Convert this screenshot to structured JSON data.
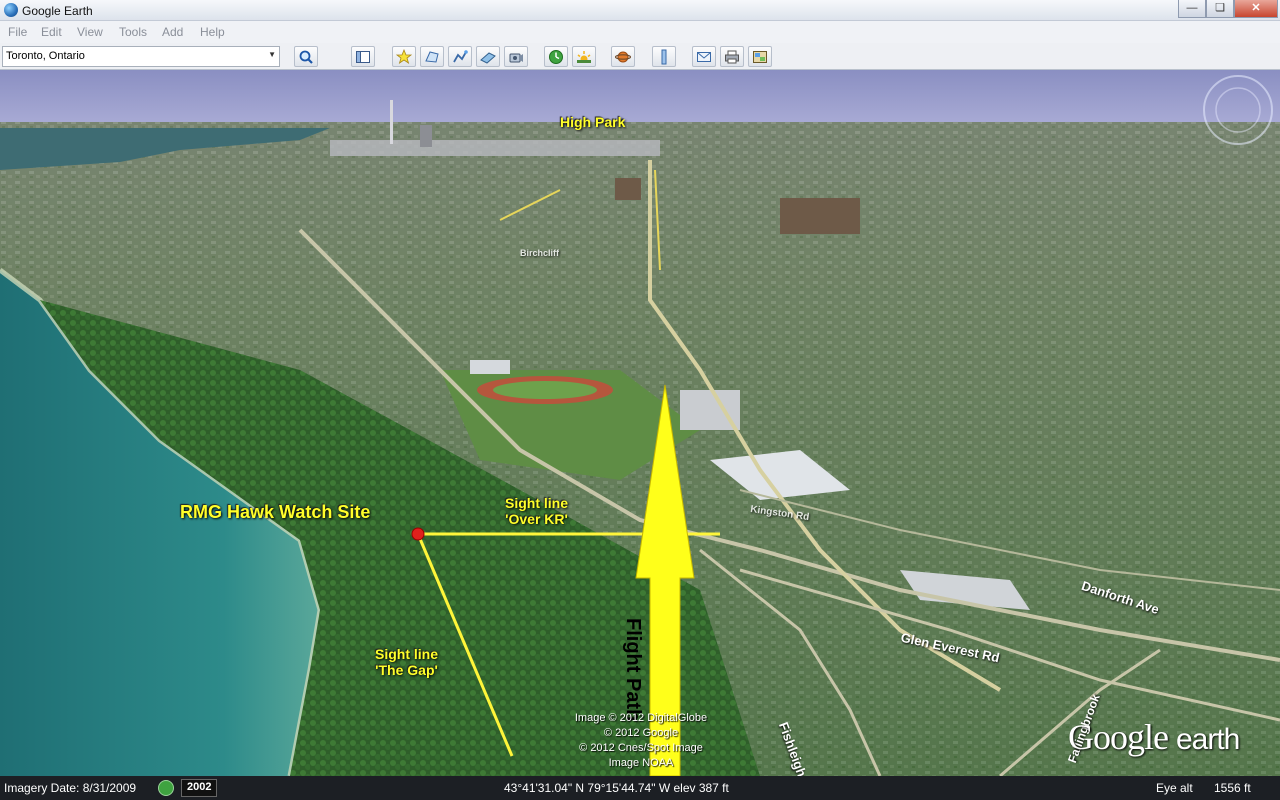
{
  "window": {
    "title": "Google Earth"
  },
  "menu": [
    "File",
    "Edit",
    "View",
    "Tools",
    "Add",
    "Help"
  ],
  "search": {
    "value": "Toronto, Ontario"
  },
  "map": {
    "labels": {
      "high_park": "High Park",
      "site": "RMG Hawk Watch Site",
      "sight_kr_1": "Sight line",
      "sight_kr_2": "'Over KR'",
      "sight_gap_1": "Sight line",
      "sight_gap_2": "'The Gap'",
      "flight_path": "Flight Path"
    },
    "roads": {
      "danforth": "Danforth Ave",
      "glen_everest": "Glen Everest Rd",
      "fishleigh": "Fishleigh Dr",
      "kingston": "Kingston Rd",
      "fallingbrook": "Fallingbrook",
      "birchcliff": "Birchcliff"
    },
    "credits": [
      "Image © 2012 DigitalGlobe",
      "© 2012 Google",
      "© 2012 Cnes/Spot Image",
      "Image NOAA"
    ],
    "brand_main": "Google",
    "brand_sub": "earth"
  },
  "status": {
    "imagery_date": "Imagery Date: 8/31/2009",
    "year": "2002",
    "coords": "43°41'31.04\" N  79°15'44.74\" W  elev   387 ft",
    "eye_alt_label": "Eye alt",
    "eye_alt_value": "1556 ft"
  }
}
